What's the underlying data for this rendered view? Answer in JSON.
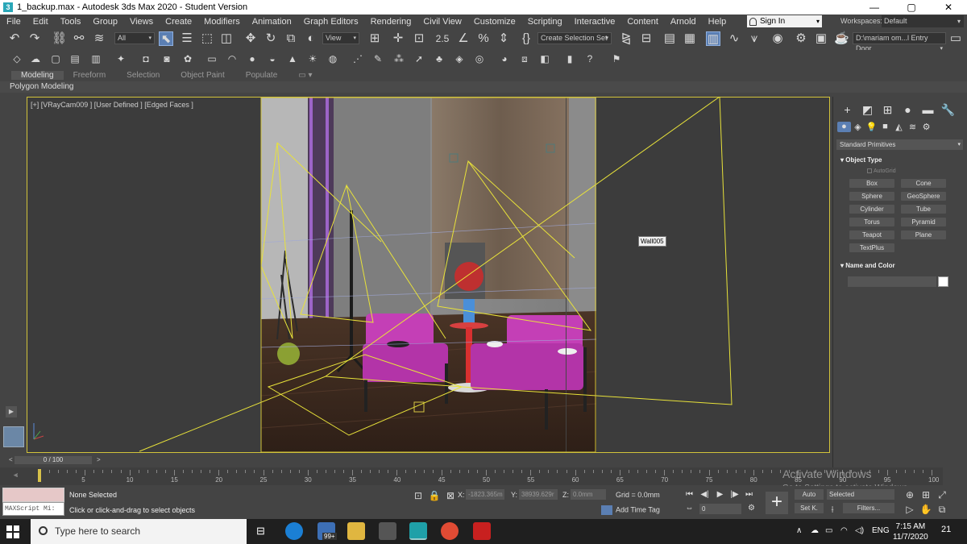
{
  "window": {
    "title": "1_backup.max - Autodesk 3ds Max 2020 - Student Version",
    "controls": [
      "—",
      "▢",
      "✕"
    ]
  },
  "menu": [
    "File",
    "Edit",
    "Tools",
    "Group",
    "Views",
    "Create",
    "Modifiers",
    "Animation",
    "Graph Editors",
    "Rendering",
    "Civil View",
    "Customize",
    "Scripting",
    "Interactive",
    "Content",
    "Arnold",
    "Help"
  ],
  "account": {
    "sign_in": "Sign In",
    "workspaces_label": "Workspaces:",
    "workspace": "Default"
  },
  "toolbar": {
    "selection_filter": "All",
    "ref_coord": "View",
    "named_selection": "Create Selection Set",
    "project_path": "D:\\mariam om...l Entry Door"
  },
  "ribbon": {
    "tabs": [
      "Modeling",
      "Freeform",
      "Selection",
      "Object Paint",
      "Populate"
    ],
    "active": "Modeling",
    "subpanel": "Polygon Modeling"
  },
  "viewport": {
    "label": "[+] [VRayCam009 ] [User Defined ] [Edged Faces ]",
    "object_tag": "Wall005",
    "accent_border": "#d2c33a"
  },
  "command_panel": {
    "category_dropdown": "Standard Primitives",
    "object_type_title": "Object Type",
    "autogrid": "AutoGrid",
    "primitives": [
      "Box",
      "Cone",
      "Sphere",
      "GeoSphere",
      "Cylinder",
      "Tube",
      "Torus",
      "Pyramid",
      "Teapot",
      "Plane",
      "TextPlus"
    ],
    "name_color_title": "Name and Color"
  },
  "timeline": {
    "frame_display": "0 / 100",
    "ticks": [
      "5",
      "10",
      "15",
      "20",
      "25",
      "30",
      "35",
      "40",
      "45",
      "50",
      "55",
      "60",
      "65",
      "70",
      "75",
      "80",
      "85",
      "90",
      "95",
      "100"
    ]
  },
  "status": {
    "maxscript": "MAXScript Mi:",
    "selection": "None Selected",
    "prompt": "Click or click-and-drag to select objects",
    "x_label": "X:",
    "x_value": "-1823.365m",
    "y_label": "Y:",
    "y_value": "38939.629r",
    "z_label": "Z:",
    "z_value": "0.0mm",
    "grid": "Grid = 0.0mm",
    "add_time_tag": "Add Time Tag",
    "current_frame": "0",
    "auto": "Auto",
    "selected": "Selected",
    "set_key": "Set K.",
    "filters": "Filters..."
  },
  "watermark": {
    "line1": "Activate Windows",
    "line2": "Go to Settings to activate Windows."
  },
  "taskbar": {
    "search_placeholder": "Type here to search",
    "mail_badge": "99+",
    "language": "ENG",
    "time": "7:15 AM",
    "date": "11/7/2020",
    "notifications": "21"
  }
}
